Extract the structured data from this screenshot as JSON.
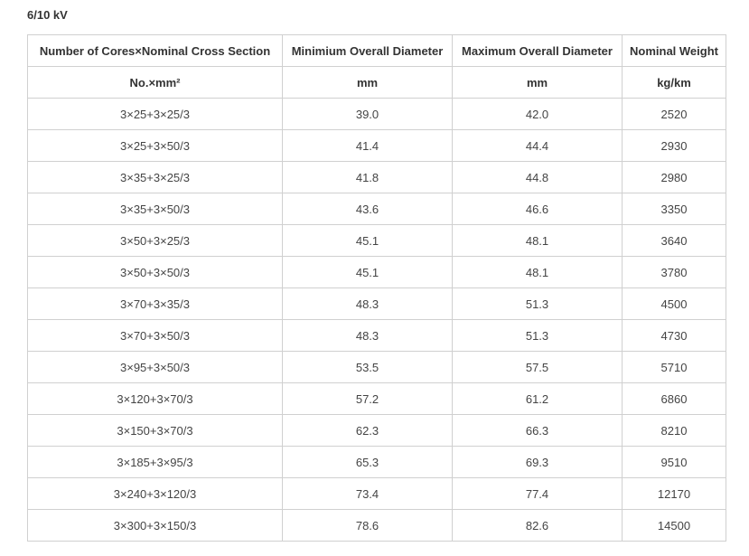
{
  "section_title": "6/10 kV",
  "table": {
    "header": [
      "Number of Cores×Nominal Cross Section",
      "Minimium Overall Diameter",
      "Maximum Overall Diameter",
      "Nominal Weight"
    ],
    "units": [
      "No.×mm²",
      "mm",
      "mm",
      "kg/km"
    ],
    "rows": [
      [
        "3×25+3×25/3",
        "39.0",
        "42.0",
        "2520"
      ],
      [
        "3×25+3×50/3",
        "41.4",
        "44.4",
        "2930"
      ],
      [
        "3×35+3×25/3",
        "41.8",
        "44.8",
        "2980"
      ],
      [
        "3×35+3×50/3",
        "43.6",
        "46.6",
        "3350"
      ],
      [
        "3×50+3×25/3",
        "45.1",
        "48.1",
        "3640"
      ],
      [
        "3×50+3×50/3",
        "45.1",
        "48.1",
        "3780"
      ],
      [
        "3×70+3×35/3",
        "48.3",
        "51.3",
        "4500"
      ],
      [
        "3×70+3×50/3",
        "48.3",
        "51.3",
        "4730"
      ],
      [
        "3×95+3×50/3",
        "53.5",
        "57.5",
        "5710"
      ],
      [
        "3×120+3×70/3",
        "57.2",
        "61.2",
        "6860"
      ],
      [
        "3×150+3×70/3",
        "62.3",
        "66.3",
        "8210"
      ],
      [
        "3×185+3×95/3",
        "65.3",
        "69.3",
        "9510"
      ],
      [
        "3×240+3×120/3",
        "73.4",
        "77.4",
        "12170"
      ],
      [
        "3×300+3×150/3",
        "78.6",
        "82.6",
        "14500"
      ]
    ]
  }
}
